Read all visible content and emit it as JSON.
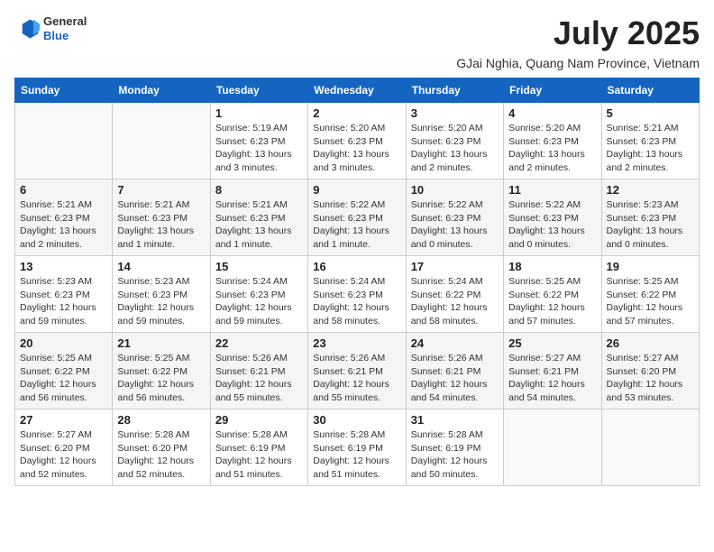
{
  "logo": {
    "line1": "General",
    "line2": "Blue"
  },
  "title": "July 2025",
  "subtitle": "GJai Nghia, Quang Nam Province, Vietnam",
  "headers": [
    "Sunday",
    "Monday",
    "Tuesday",
    "Wednesday",
    "Thursday",
    "Friday",
    "Saturday"
  ],
  "weeks": [
    [
      {
        "day": "",
        "info": ""
      },
      {
        "day": "",
        "info": ""
      },
      {
        "day": "1",
        "info": "Sunrise: 5:19 AM\nSunset: 6:23 PM\nDaylight: 13 hours and 3 minutes."
      },
      {
        "day": "2",
        "info": "Sunrise: 5:20 AM\nSunset: 6:23 PM\nDaylight: 13 hours and 3 minutes."
      },
      {
        "day": "3",
        "info": "Sunrise: 5:20 AM\nSunset: 6:23 PM\nDaylight: 13 hours and 2 minutes."
      },
      {
        "day": "4",
        "info": "Sunrise: 5:20 AM\nSunset: 6:23 PM\nDaylight: 13 hours and 2 minutes."
      },
      {
        "day": "5",
        "info": "Sunrise: 5:21 AM\nSunset: 6:23 PM\nDaylight: 13 hours and 2 minutes."
      }
    ],
    [
      {
        "day": "6",
        "info": "Sunrise: 5:21 AM\nSunset: 6:23 PM\nDaylight: 13 hours and 2 minutes."
      },
      {
        "day": "7",
        "info": "Sunrise: 5:21 AM\nSunset: 6:23 PM\nDaylight: 13 hours and 1 minute."
      },
      {
        "day": "8",
        "info": "Sunrise: 5:21 AM\nSunset: 6:23 PM\nDaylight: 13 hours and 1 minute."
      },
      {
        "day": "9",
        "info": "Sunrise: 5:22 AM\nSunset: 6:23 PM\nDaylight: 13 hours and 1 minute."
      },
      {
        "day": "10",
        "info": "Sunrise: 5:22 AM\nSunset: 6:23 PM\nDaylight: 13 hours and 0 minutes."
      },
      {
        "day": "11",
        "info": "Sunrise: 5:22 AM\nSunset: 6:23 PM\nDaylight: 13 hours and 0 minutes."
      },
      {
        "day": "12",
        "info": "Sunrise: 5:23 AM\nSunset: 6:23 PM\nDaylight: 13 hours and 0 minutes."
      }
    ],
    [
      {
        "day": "13",
        "info": "Sunrise: 5:23 AM\nSunset: 6:23 PM\nDaylight: 12 hours and 59 minutes."
      },
      {
        "day": "14",
        "info": "Sunrise: 5:23 AM\nSunset: 6:23 PM\nDaylight: 12 hours and 59 minutes."
      },
      {
        "day": "15",
        "info": "Sunrise: 5:24 AM\nSunset: 6:23 PM\nDaylight: 12 hours and 59 minutes."
      },
      {
        "day": "16",
        "info": "Sunrise: 5:24 AM\nSunset: 6:23 PM\nDaylight: 12 hours and 58 minutes."
      },
      {
        "day": "17",
        "info": "Sunrise: 5:24 AM\nSunset: 6:22 PM\nDaylight: 12 hours and 58 minutes."
      },
      {
        "day": "18",
        "info": "Sunrise: 5:25 AM\nSunset: 6:22 PM\nDaylight: 12 hours and 57 minutes."
      },
      {
        "day": "19",
        "info": "Sunrise: 5:25 AM\nSunset: 6:22 PM\nDaylight: 12 hours and 57 minutes."
      }
    ],
    [
      {
        "day": "20",
        "info": "Sunrise: 5:25 AM\nSunset: 6:22 PM\nDaylight: 12 hours and 56 minutes."
      },
      {
        "day": "21",
        "info": "Sunrise: 5:25 AM\nSunset: 6:22 PM\nDaylight: 12 hours and 56 minutes."
      },
      {
        "day": "22",
        "info": "Sunrise: 5:26 AM\nSunset: 6:21 PM\nDaylight: 12 hours and 55 minutes."
      },
      {
        "day": "23",
        "info": "Sunrise: 5:26 AM\nSunset: 6:21 PM\nDaylight: 12 hours and 55 minutes."
      },
      {
        "day": "24",
        "info": "Sunrise: 5:26 AM\nSunset: 6:21 PM\nDaylight: 12 hours and 54 minutes."
      },
      {
        "day": "25",
        "info": "Sunrise: 5:27 AM\nSunset: 6:21 PM\nDaylight: 12 hours and 54 minutes."
      },
      {
        "day": "26",
        "info": "Sunrise: 5:27 AM\nSunset: 6:20 PM\nDaylight: 12 hours and 53 minutes."
      }
    ],
    [
      {
        "day": "27",
        "info": "Sunrise: 5:27 AM\nSunset: 6:20 PM\nDaylight: 12 hours and 52 minutes."
      },
      {
        "day": "28",
        "info": "Sunrise: 5:28 AM\nSunset: 6:20 PM\nDaylight: 12 hours and 52 minutes."
      },
      {
        "day": "29",
        "info": "Sunrise: 5:28 AM\nSunset: 6:19 PM\nDaylight: 12 hours and 51 minutes."
      },
      {
        "day": "30",
        "info": "Sunrise: 5:28 AM\nSunset: 6:19 PM\nDaylight: 12 hours and 51 minutes."
      },
      {
        "day": "31",
        "info": "Sunrise: 5:28 AM\nSunset: 6:19 PM\nDaylight: 12 hours and 50 minutes."
      },
      {
        "day": "",
        "info": ""
      },
      {
        "day": "",
        "info": ""
      }
    ]
  ]
}
